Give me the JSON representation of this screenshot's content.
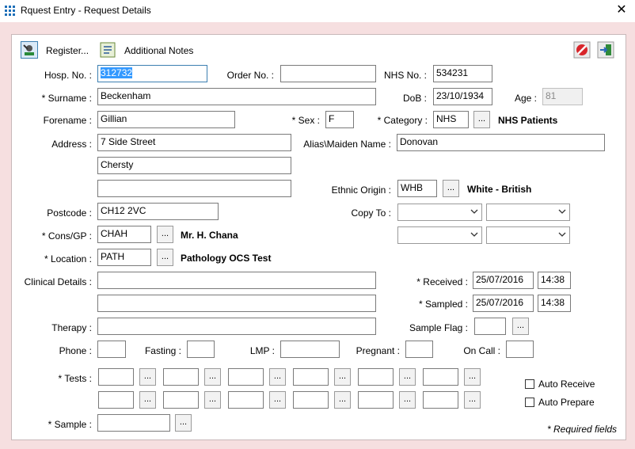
{
  "window": {
    "title": "Rquest Entry - Request Details"
  },
  "toolbar": {
    "register_label": "Register...",
    "notes_label": "Additional Notes"
  },
  "labels": {
    "hosp_no": "Hosp. No. :",
    "order_no": "Order No. :",
    "nhs_no": "NHS No. :",
    "surname": "* Surname :",
    "dob": "DoB :",
    "age": "Age :",
    "forename": "Forename :",
    "sex": "* Sex :",
    "category": "* Category :",
    "address": "Address :",
    "alias": "Alias\\Maiden Name :",
    "ethnic": "Ethnic Origin :",
    "postcode": "Postcode :",
    "copy_to": "Copy To :",
    "cons_gp": "* Cons/GP :",
    "location": "* Location :",
    "clinical": "Clinical Details :",
    "received": "* Received :",
    "sampled": "* Sampled :",
    "therapy": "Therapy :",
    "sample_flag": "Sample Flag :",
    "phone": "Phone :",
    "fasting": "Fasting :",
    "lmp": "LMP :",
    "pregnant": "Pregnant :",
    "on_call": "On Call :",
    "tests": "* Tests :",
    "sample": "* Sample :"
  },
  "fields": {
    "hosp_no": "312732",
    "order_no": "",
    "nhs_no": "534231",
    "surname": "Beckenham",
    "dob": "23/10/1934",
    "age": "81",
    "forename": "Gillian",
    "sex": "F",
    "category": "NHS",
    "category_desc": "NHS Patients",
    "address1": "7 Side Street",
    "address2": "Chersty",
    "address3": "",
    "alias": "Donovan",
    "ethnic": "WHB",
    "ethnic_desc": "White - British",
    "postcode": "CH12 2VC",
    "cons_gp": "CHAH",
    "cons_gp_desc": "Mr. H. Chana",
    "location": "PATH",
    "location_desc": "Pathology OCS Test",
    "received_date": "25/07/2016",
    "received_time": "14:38",
    "sampled_date": "25/07/2016",
    "sampled_time": "14:38"
  },
  "lookup_button": "...",
  "checkboxes": {
    "auto_receive": "Auto Receive",
    "auto_prepare": "Auto Prepare"
  },
  "footer": {
    "required_note": "* Required fields"
  }
}
